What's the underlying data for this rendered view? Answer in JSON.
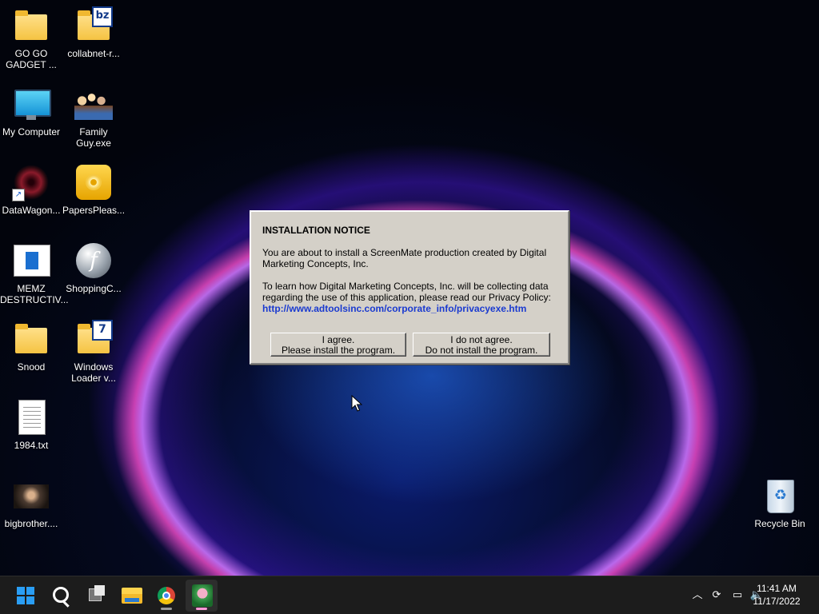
{
  "desktop": {
    "icons": [
      {
        "label": "GO GO\nGADGET ...",
        "icon": "folder-icon"
      },
      {
        "label": "collabnet-r...",
        "icon": "zip-folder-icon",
        "badge": "bz"
      },
      {
        "label": "My Computer",
        "icon": "monitor-icon"
      },
      {
        "label": "Family\nGuy.exe",
        "icon": "family-guy-icon"
      },
      {
        "label": "DataWagon...",
        "icon": "web-icon"
      },
      {
        "label": "PapersPleas...",
        "icon": "disc-icon"
      },
      {
        "label": "MEMZ\nDESTRUCTIV...",
        "icon": "window-app-icon"
      },
      {
        "label": "ShoppingC...",
        "icon": "flash-icon",
        "glyph": "f"
      },
      {
        "label": "Snood",
        "icon": "folder-icon"
      },
      {
        "label": "Windows\nLoader v...",
        "icon": "archive-folder-icon",
        "badge": "7"
      },
      {
        "label": "1984.txt",
        "icon": "text-file-icon"
      },
      {
        "label": "bigbrother....",
        "icon": "photo-icon"
      },
      {
        "label": "Recycle Bin",
        "icon": "recycle-bin-icon"
      }
    ]
  },
  "dialog": {
    "title": "INSTALLATION NOTICE",
    "paragraph1": "You are about to install a ScreenMate production created by Digital Marketing Concepts, Inc.",
    "paragraph2": "To learn how Digital Marketing Concepts, Inc. will be collecting data regarding the use of this application, please read our Privacy Policy:",
    "link": "http://www.adtoolsinc.com/corporate_info/privacyexe.htm",
    "agree_button": "I agree.\nPlease install the program.",
    "disagree_button": "I do not agree.\nDo not install the program."
  },
  "taskbar": {
    "pinned": [
      "start-icon",
      "search-icon",
      "task-view-icon",
      "file-explorer-icon",
      "chrome-icon",
      "screenmate-app-icon"
    ],
    "tray_icons": [
      "chevron-up-icon",
      "sync-icon",
      "network-icon",
      "volume-icon"
    ],
    "time": "11:41 AM",
    "date": "11/17/2022"
  }
}
